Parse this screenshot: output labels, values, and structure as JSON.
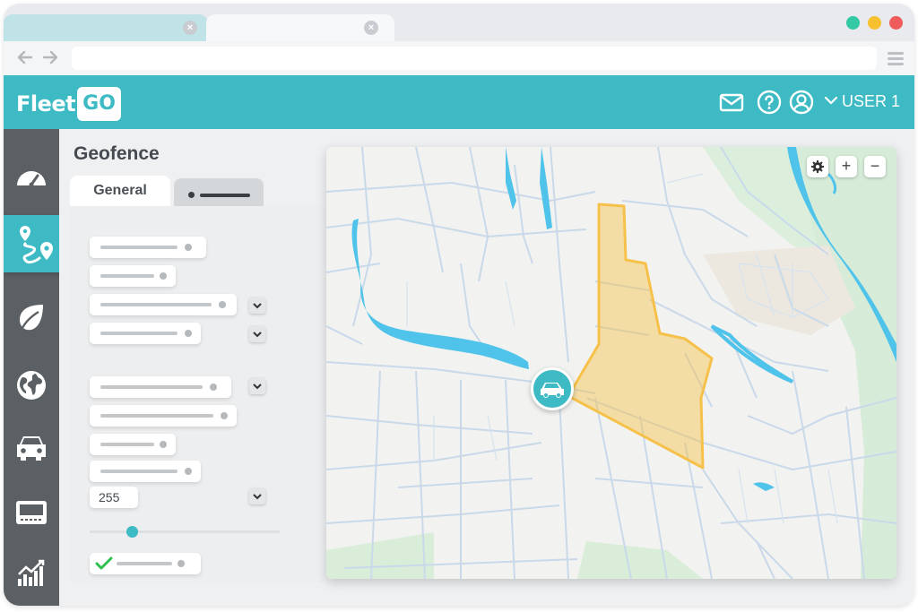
{
  "browser": {
    "tabs": [
      {
        "close": "×"
      },
      {
        "close": "×"
      }
    ],
    "window_controls": {
      "colors": [
        "#33c9a5",
        "#f7c02e",
        "#f05c5c"
      ]
    },
    "nav": {
      "back_icon": "arrow-left-icon",
      "forward_icon": "arrow-right-icon"
    },
    "address": {
      "value": ""
    }
  },
  "app": {
    "logo_text": "Fleet",
    "logo_badge": "GO",
    "header_icons": [
      "mail-icon",
      "help-icon",
      "user-icon"
    ],
    "user_label": "USER 1",
    "accent": "#3dbac4",
    "sidebar_color": "#5b6064"
  },
  "sidebar": {
    "items": [
      {
        "icon": "speedometer-icon",
        "active": false
      },
      {
        "icon": "route-icon",
        "active": true
      },
      {
        "icon": "leaf-icon",
        "active": false
      },
      {
        "icon": "globe-icon",
        "active": false
      },
      {
        "icon": "car-icon",
        "active": false
      },
      {
        "icon": "terminal-icon",
        "active": false
      },
      {
        "icon": "analytics-icon",
        "active": false
      }
    ]
  },
  "page": {
    "title": "Geofence",
    "tabs": [
      {
        "label": "General"
      }
    ]
  },
  "form": {
    "number_value": "255",
    "slider_value": 0.22,
    "checkbox_checked": true
  },
  "map": {
    "controls": [
      "settings-icon",
      "+",
      "−"
    ],
    "geofence_color": "#f6c14a",
    "water_color": "#4fc3ea",
    "park_color": "#d6ecd8",
    "vehicle_icon": "car-icon"
  }
}
